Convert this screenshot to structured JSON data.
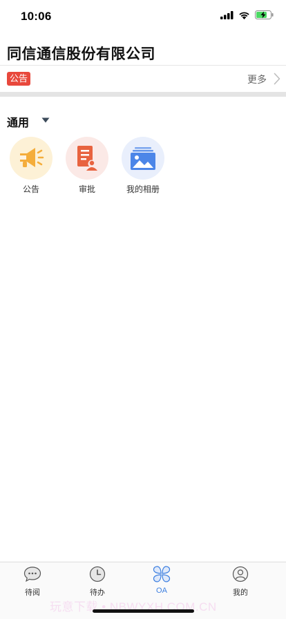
{
  "status_bar": {
    "time": "10:06",
    "battery_level": 0.75
  },
  "header": {
    "title": "同信通信股份有限公司"
  },
  "notice": {
    "badge": "公告",
    "more_label": "更多"
  },
  "section": {
    "title": "通用"
  },
  "apps": [
    {
      "label": "公告",
      "icon": "megaphone-icon",
      "bg": "#fdf1d6",
      "color": "#f4ad3b"
    },
    {
      "label": "审批",
      "icon": "approval-icon",
      "bg": "#fbe9e6",
      "color": "#e8633f"
    },
    {
      "label": "我的相册",
      "icon": "album-icon",
      "bg": "#e9effc",
      "color": "#4c86e8"
    }
  ],
  "tabs": [
    {
      "label": "待阅",
      "icon": "chat-bubble-icon",
      "active": false
    },
    {
      "label": "待办",
      "icon": "clock-icon",
      "active": false
    },
    {
      "label": "OA",
      "icon": "clover-icon",
      "active": true
    },
    {
      "label": "我的",
      "icon": "person-icon",
      "active": false
    }
  ],
  "colors": {
    "accent": "#3b7ee0",
    "badge": "#e8483c"
  },
  "watermark": "玩意下载 • NBWYXH.COM.CN"
}
